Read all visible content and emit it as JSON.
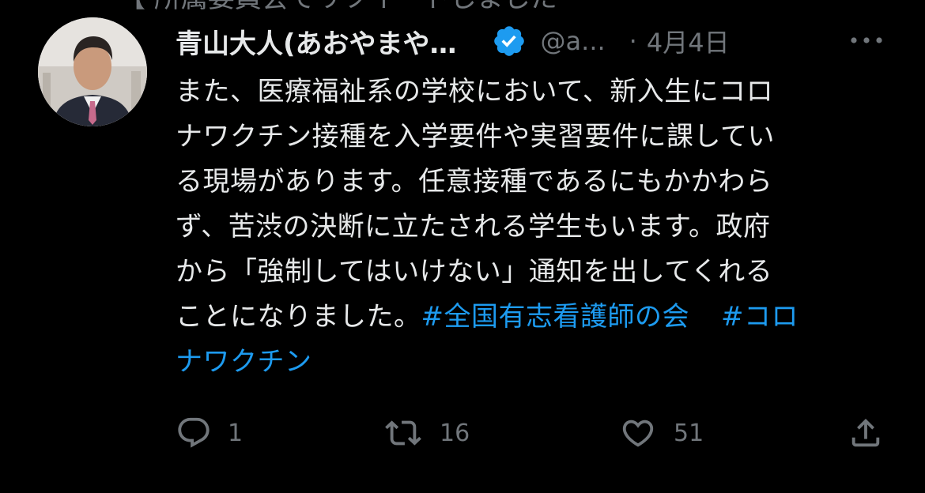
{
  "previous_item_fragment": "【 所属委員会でリツイートしました",
  "tweet": {
    "display_name": "青山大人(あおやまや…",
    "verified": true,
    "handle": "@a...",
    "separator": "·",
    "date": "4月4日",
    "text_lines": [
      "また、医療福祉系の学校において、新入生にコロ",
      "ナワクチン接種を入学要件や実習要件に課してい",
      "る現場があります。任意接種であるにもかかわら",
      "ず、苦渋の決断に立たされる学生もいます。政府",
      "から「強制してはいけない」通知を出してくれる"
    ],
    "last_line_text": "ことになりました。",
    "hashtags": [
      "#全国有志看護師の会",
      "#コロ",
      "ナワクチン"
    ]
  },
  "actions": {
    "reply": {
      "icon": "reply-icon",
      "count": "1"
    },
    "retweet": {
      "icon": "retweet-icon",
      "count": "16"
    },
    "like": {
      "icon": "heart-icon",
      "count": "51"
    },
    "share": {
      "icon": "share-icon"
    }
  },
  "colors": {
    "background": "#000000",
    "text": "#e7e9ea",
    "secondary": "#71767b",
    "accent": "#1d9bf0"
  }
}
